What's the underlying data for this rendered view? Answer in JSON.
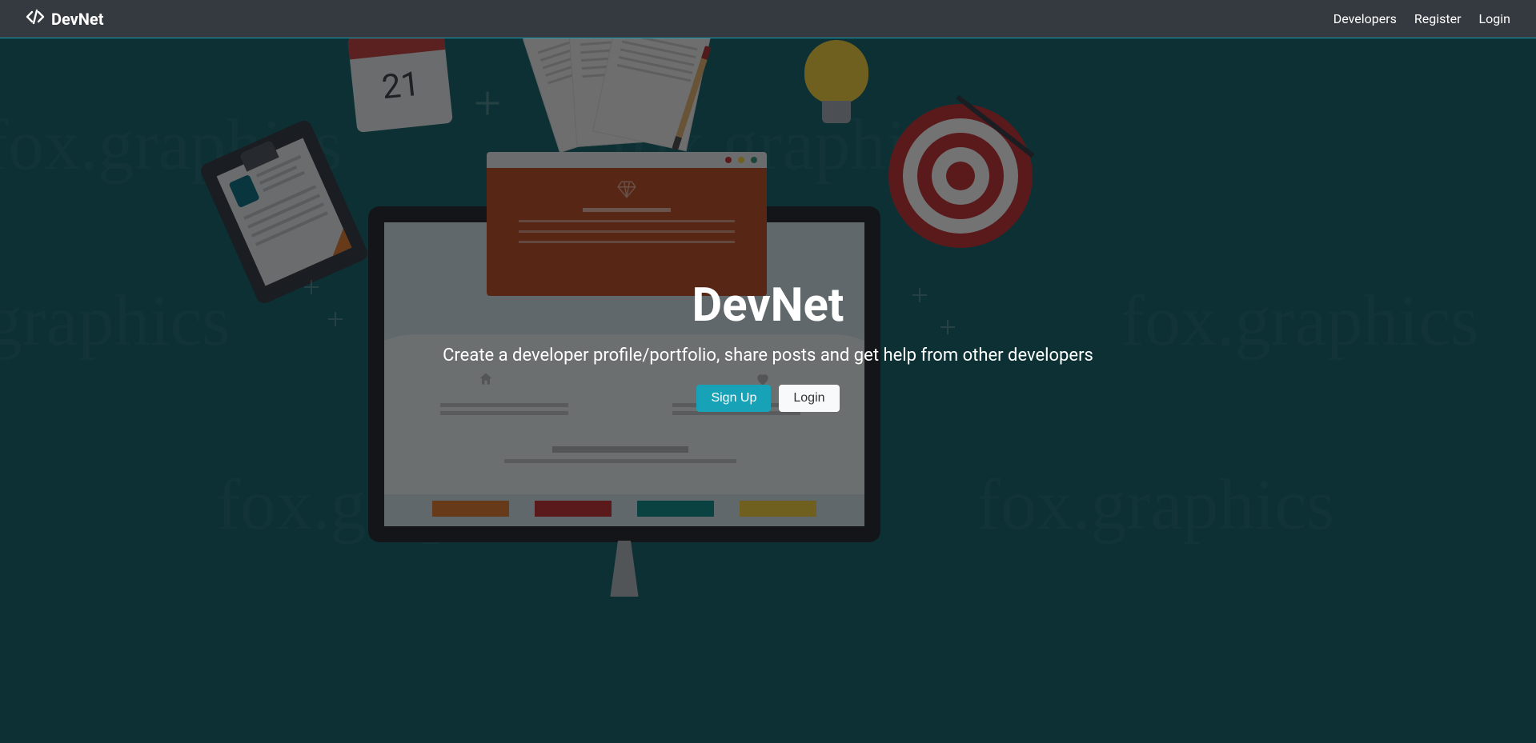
{
  "navbar": {
    "brand": "DevNet",
    "links": {
      "developers": "Developers",
      "register": "Register",
      "login": "Login"
    }
  },
  "hero": {
    "title": "DevNet",
    "subtitle": "Create a developer profile/portfolio, share posts and get help from other developers",
    "buttons": {
      "signup": "Sign Up",
      "login": "Login"
    }
  },
  "background": {
    "watermark_text": "fox.graphics",
    "calendar_day": "21"
  },
  "colors": {
    "navbar_bg": "#343a40",
    "accent": "#17a2b8",
    "hero_overlay": "rgba(0,0,0,0.55)",
    "bg_base": "#1c6b74"
  }
}
